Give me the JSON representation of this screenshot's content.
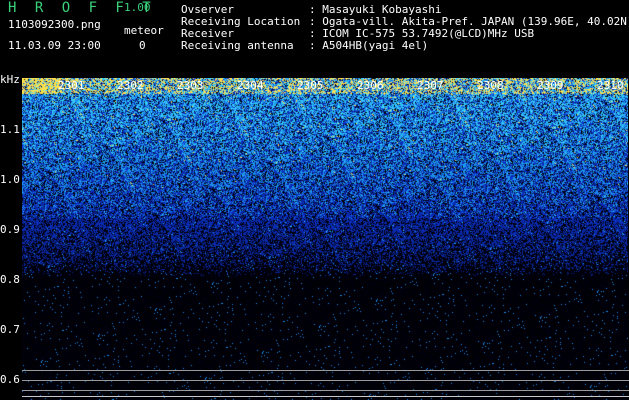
{
  "header": {
    "logo": "H R O F F T",
    "version": "1.00",
    "filename": "1103092300.png",
    "meteor_label": "meteor",
    "datetime": "11.03.09 23:00",
    "meteor_count": "0"
  },
  "info": {
    "observer_label": "Ovserver",
    "observer_value": ": Masayuki Kobayashi",
    "location_label": "Receiving Location",
    "location_value": ": Ogata-vill. Akita-Pref. JAPAN (139.96E, 40.02N)",
    "receiver_label": "Receiver",
    "receiver_value": ": ICOM IC-575 53.7492(@LCD)MHz USB",
    "antenna_label": "Receiving antenna",
    "antenna_value": ": A504HB(yagi 4el)"
  },
  "axes": {
    "y_unit": "kHz",
    "y_ticks": [
      "1.1",
      "1.0",
      "0.9",
      "0.8",
      "0.7",
      "0.6"
    ],
    "x_ticks": [
      "2301",
      "2302",
      "2303",
      "2304",
      "2305",
      "2306",
      "2307",
      "2308",
      "2309",
      "2310"
    ]
  },
  "colors": {
    "logo": "#3bd17b",
    "text": "#ffffff",
    "background": "#000000",
    "noise_low": "#0a1a66",
    "noise_mid": "#1e46d8",
    "noise_high": "#2fd0ff",
    "peak": "#ffe24a"
  }
}
